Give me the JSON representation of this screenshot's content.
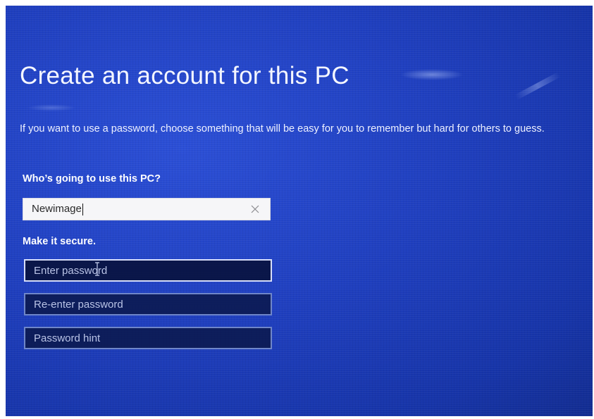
{
  "page": {
    "title": "Create an account for this PC",
    "description": "If you want to use a password, choose something that will be easy for you to remember but hard for others to guess."
  },
  "user_section": {
    "label": "Who’s going to use this PC?",
    "username_value": "Newimage",
    "clear_icon": "close-icon"
  },
  "secure_section": {
    "label": "Make it secure.",
    "password_placeholder": "Enter password",
    "reenter_placeholder": "Re-enter password",
    "hint_placeholder": "Password hint"
  },
  "colors": {
    "background_blue": "#1f3fbf",
    "text": "#ffffff",
    "input_light": "#f6f6f8",
    "input_dark": "#0a1646"
  }
}
